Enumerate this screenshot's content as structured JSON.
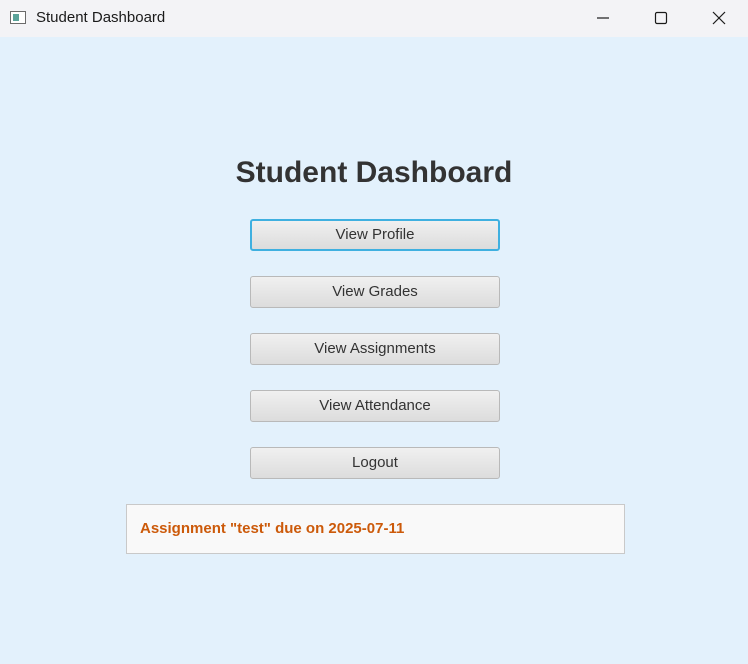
{
  "window": {
    "title": "Student Dashboard"
  },
  "main": {
    "heading": "Student Dashboard",
    "buttons": [
      {
        "label": "View Profile",
        "focused": true
      },
      {
        "label": "View Grades"
      },
      {
        "label": "View Assignments"
      },
      {
        "label": "View Attendance"
      },
      {
        "label": "Logout"
      }
    ],
    "notification": "Assignment \"test\" due on 2025-07-11"
  },
  "colors": {
    "background": "#e3f1fc",
    "focus_ring": "#3fb0e0",
    "notification_text": "#cc5a0a"
  },
  "icons": {
    "app": "app-icon",
    "minimize": "minimize-icon",
    "maximize": "maximize-icon",
    "close": "close-icon"
  }
}
